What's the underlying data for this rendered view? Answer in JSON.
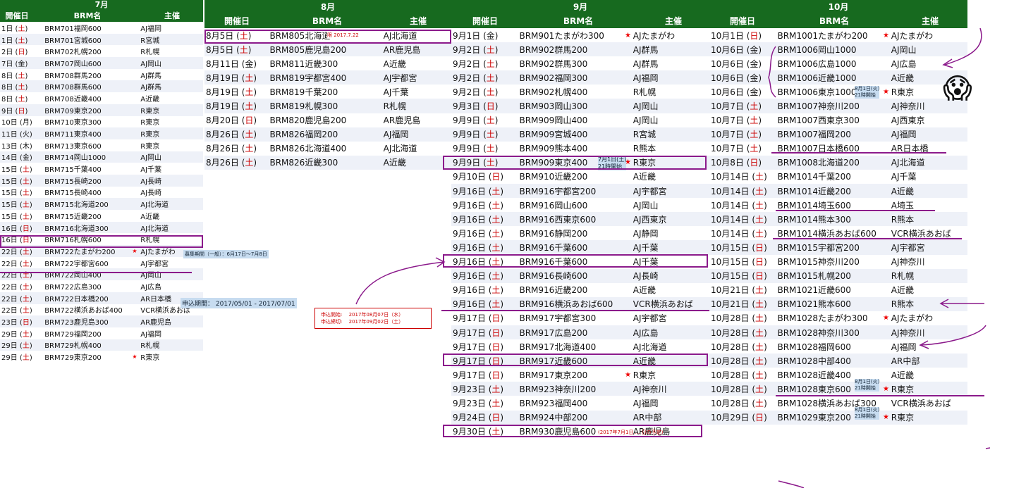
{
  "headers": {
    "date": "開催日",
    "brm": "BRM名",
    "org": "主催"
  },
  "july": {
    "title": "7月",
    "rows": [
      [
        "1日",
        "土",
        "BRM701福岡600",
        "AJ福岡",
        ""
      ],
      [
        "1日",
        "土",
        "BRM701宮城600",
        "R宮城",
        ""
      ],
      [
        "2日",
        "日",
        "BRM702札幌200",
        "R札幌",
        ""
      ],
      [
        "7日",
        "金",
        "BRM707岡山600",
        "AJ岡山",
        ""
      ],
      [
        "8日",
        "土",
        "BRM708群馬200",
        "AJ群馬",
        ""
      ],
      [
        "8日",
        "土",
        "BRM708群馬600",
        "AJ群馬",
        ""
      ],
      [
        "8日",
        "土",
        "BRM708近畿400",
        "A近畿",
        ""
      ],
      [
        "9日",
        "日",
        "BRM709東京200",
        "R東京",
        ""
      ],
      [
        "10日",
        "月",
        "BRM710東京300",
        "R東京",
        ""
      ],
      [
        "11日",
        "火",
        "BRM711東京400",
        "R東京",
        ""
      ],
      [
        "13日",
        "木",
        "BRM713東京600",
        "R東京",
        ""
      ],
      [
        "14日",
        "金",
        "BRM714岡山1000",
        "AJ岡山",
        ""
      ],
      [
        "15日",
        "土",
        "BRM715千葉400",
        "AJ千葉",
        ""
      ],
      [
        "15日",
        "土",
        "BRM715長崎200",
        "AJ長崎",
        ""
      ],
      [
        "15日",
        "土",
        "BRM715長崎400",
        "AJ長崎",
        ""
      ],
      [
        "15日",
        "土",
        "BRM715北海道200",
        "AJ北海道",
        ""
      ],
      [
        "15日",
        "土",
        "BRM715近畿200",
        "A近畿",
        ""
      ],
      [
        "16日",
        "日",
        "BRM716北海道300",
        "AJ北海道",
        ""
      ],
      [
        "16日",
        "日",
        "BRM716札幌600",
        "R札幌",
        ""
      ],
      [
        "22日",
        "土",
        "BRM722たまがわ200",
        "AJたまがわ",
        "★"
      ],
      [
        "22日",
        "土",
        "BRM722宇都宮600",
        "AJ宇都宮",
        ""
      ],
      [
        "22日",
        "土",
        "BRM722岡山400",
        "AJ岡山",
        ""
      ],
      [
        "22日",
        "土",
        "BRM722広島300",
        "AJ広島",
        ""
      ],
      [
        "22日",
        "土",
        "BRM722日本橋200",
        "AR日本橋",
        ""
      ],
      [
        "22日",
        "土",
        "BRM722横浜あおば400",
        "VCR横浜あおば",
        ""
      ],
      [
        "23日",
        "日",
        "BRM723鹿児島300",
        "AR鹿児島",
        ""
      ],
      [
        "29日",
        "土",
        "BRM729福岡200",
        "AJ福岡",
        ""
      ],
      [
        "29日",
        "土",
        "BRM729札幌400",
        "R札幌",
        ""
      ],
      [
        "29日",
        "土",
        "BRM729東京200",
        "R東京",
        "★"
      ]
    ]
  },
  "august": {
    "title": "8月",
    "rows": [
      [
        "8月5日",
        "土",
        "BRM805北海道600",
        "AJ北海道",
        ""
      ],
      [
        "8月5日",
        "土",
        "BRM805鹿児島200",
        "AR鹿児島",
        ""
      ],
      [
        "8月11日",
        "金",
        "BRM811近畿300",
        "A近畿",
        ""
      ],
      [
        "8月19日",
        "土",
        "BRM819宇都宮400",
        "AJ宇都宮",
        ""
      ],
      [
        "8月19日",
        "土",
        "BRM819千葉200",
        "AJ千葉",
        ""
      ],
      [
        "8月19日",
        "土",
        "BRM819札幌300",
        "R札幌",
        ""
      ],
      [
        "8月20日",
        "日",
        "BRM820鹿児島200",
        "AR鹿児島",
        ""
      ],
      [
        "8月26日",
        "土",
        "BRM826福岡200",
        "AJ福岡",
        ""
      ],
      [
        "8月26日",
        "土",
        "BRM826北海道400",
        "AJ北海道",
        ""
      ],
      [
        "8月26日",
        "土",
        "BRM826近畿300",
        "A近畿",
        ""
      ]
    ]
  },
  "september": {
    "title": "9月",
    "rows": [
      [
        "9月1日",
        "金",
        "BRM901たまがわ300",
        "AJたまがわ",
        "★"
      ],
      [
        "9月2日",
        "土",
        "BRM902群馬200",
        "AJ群馬",
        ""
      ],
      [
        "9月2日",
        "土",
        "BRM902群馬300",
        "AJ群馬",
        ""
      ],
      [
        "9月2日",
        "土",
        "BRM902福岡300",
        "AJ福岡",
        ""
      ],
      [
        "9月2日",
        "土",
        "BRM902札幌400",
        "R札幌",
        ""
      ],
      [
        "9月3日",
        "日",
        "BRM903岡山300",
        "AJ岡山",
        ""
      ],
      [
        "9月9日",
        "土",
        "BRM909岡山400",
        "AJ岡山",
        ""
      ],
      [
        "9月9日",
        "土",
        "BRM909宮城400",
        "R宮城",
        ""
      ],
      [
        "9月9日",
        "土",
        "BRM909熊本400",
        "R熊本",
        ""
      ],
      [
        "9月9日",
        "土",
        "BRM909東京400",
        "R東京",
        "★"
      ],
      [
        "9月10日",
        "日",
        "BRM910近畿200",
        "A近畿",
        ""
      ],
      [
        "9月16日",
        "土",
        "BRM916宇都宮200",
        "AJ宇都宮",
        ""
      ],
      [
        "9月16日",
        "土",
        "BRM916岡山600",
        "AJ岡山",
        ""
      ],
      [
        "9月16日",
        "土",
        "BRM916西東京600",
        "AJ西東京",
        ""
      ],
      [
        "9月16日",
        "土",
        "BRM916静岡200",
        "AJ静岡",
        ""
      ],
      [
        "9月16日",
        "土",
        "BRM916千葉600",
        "AJ千葉",
        ""
      ],
      [
        "9月16日",
        "土",
        "BRM916千葉600",
        "AJ千葉",
        ""
      ],
      [
        "9月16日",
        "土",
        "BRM916長崎600",
        "AJ長崎",
        ""
      ],
      [
        "9月16日",
        "土",
        "BRM916近畿200",
        "A近畿",
        ""
      ],
      [
        "9月16日",
        "土",
        "BRM916横浜あおば600",
        "VCR横浜あおば",
        ""
      ],
      [
        "9月17日",
        "日",
        "BRM917宇都宮300",
        "AJ宇都宮",
        ""
      ],
      [
        "9月17日",
        "日",
        "BRM917広島200",
        "AJ広島",
        ""
      ],
      [
        "9月17日",
        "日",
        "BRM917北海道400",
        "AJ北海道",
        ""
      ],
      [
        "9月17日",
        "日",
        "BRM917近畿600",
        "A近畿",
        ""
      ],
      [
        "9月17日",
        "日",
        "BRM917東京200",
        "R東京",
        "★"
      ],
      [
        "9月23日",
        "土",
        "BRM923神奈川200",
        "AJ神奈川",
        ""
      ],
      [
        "9月23日",
        "土",
        "BRM923福岡400",
        "AJ福岡",
        ""
      ],
      [
        "9月24日",
        "日",
        "BRM924中部200",
        "AR中部",
        ""
      ],
      [
        "9月30日",
        "土",
        "BRM930鹿児島600",
        "AR鹿児島",
        ""
      ]
    ]
  },
  "october": {
    "title": "10月",
    "rows": [
      [
        "10月1日",
        "日",
        "BRM1001たまがわ200",
        "AJたまがわ",
        "★"
      ],
      [
        "10月6日",
        "金",
        "BRM1006岡山1000",
        "AJ岡山",
        ""
      ],
      [
        "10月6日",
        "金",
        "BRM1006広島1000",
        "AJ広島",
        ""
      ],
      [
        "10月6日",
        "金",
        "BRM1006近畿1000",
        "A近畿",
        ""
      ],
      [
        "10月6日",
        "金",
        "BRM1006東京1000",
        "R東京",
        "★"
      ],
      [
        "10月7日",
        "土",
        "BRM1007神奈川200",
        "AJ神奈川",
        ""
      ],
      [
        "10月7日",
        "土",
        "BRM1007西東京300",
        "AJ西東京",
        ""
      ],
      [
        "10月7日",
        "土",
        "BRM1007福岡200",
        "AJ福岡",
        ""
      ],
      [
        "10月7日",
        "土",
        "BRM1007日本橋600",
        "AR日本橋",
        ""
      ],
      [
        "10月8日",
        "日",
        "BRM1008北海道200",
        "AJ北海道",
        ""
      ],
      [
        "10月14日",
        "土",
        "BRM1014千葉200",
        "AJ千葉",
        ""
      ],
      [
        "10月14日",
        "土",
        "BRM1014近畿200",
        "A近畿",
        ""
      ],
      [
        "10月14日",
        "土",
        "BRM1014埼玉600",
        "A埼玉",
        ""
      ],
      [
        "10月14日",
        "土",
        "BRM1014熊本300",
        "R熊本",
        ""
      ],
      [
        "10月14日",
        "土",
        "BRM1014横浜あおば600",
        "VCR横浜あおば",
        ""
      ],
      [
        "10月15日",
        "日",
        "BRM1015宇都宮200",
        "AJ宇都宮",
        ""
      ],
      [
        "10月15日",
        "日",
        "BRM1015神奈川200",
        "AJ神奈川",
        ""
      ],
      [
        "10月15日",
        "日",
        "BRM1015札幌200",
        "R札幌",
        ""
      ],
      [
        "10月21日",
        "土",
        "BRM1021近畿600",
        "A近畿",
        ""
      ],
      [
        "10月21日",
        "土",
        "BRM1021熊本600",
        "R熊本",
        ""
      ],
      [
        "10月28日",
        "土",
        "BRM1028たまがわ300",
        "AJたまがわ",
        "★"
      ],
      [
        "10月28日",
        "土",
        "BRM1028神奈川300",
        "AJ神奈川",
        ""
      ],
      [
        "10月28日",
        "土",
        "BRM1028福岡600",
        "AJ福岡",
        ""
      ],
      [
        "10月28日",
        "土",
        "BRM1028中部400",
        "AR中部",
        ""
      ],
      [
        "10月28日",
        "土",
        "BRM1028近畿400",
        "A近畿",
        ""
      ],
      [
        "10月28日",
        "土",
        "BRM1028東京600",
        "R東京",
        "★"
      ],
      [
        "10月28日",
        "土",
        "BRM1028横浜あおば300",
        "VCR横浜あおば",
        ""
      ],
      [
        "10月29日",
        "日",
        "BRM1029東京200",
        "R東京",
        "★"
      ]
    ]
  },
  "notes": {
    "jul_recruit": "募集期間（一般）：6月17日～7月8日",
    "jul_apply": "申込期間：  2017/05/01 - 2017/07/01",
    "aug_limit": "限  2017.7.22",
    "sep_909": "7月1日(土)\n21時開始",
    "aug_box": "申込開始:　 2017年08月07日（水）\n申込締切:　 2017年09月02日（土）",
    "sep_930": "(2017年7月1日 ... 日の予定)",
    "oct_1006": "8月1日(火)\n21時開始",
    "oct_1028": "8月1日(火)\n21時開始",
    "oct_1029": "8月1日(火)\n21時開始"
  },
  "emoji": "😱",
  "colors": {
    "header": "#176a1f",
    "annotation": "#8b1a8b",
    "weekend": "#cc0000"
  }
}
